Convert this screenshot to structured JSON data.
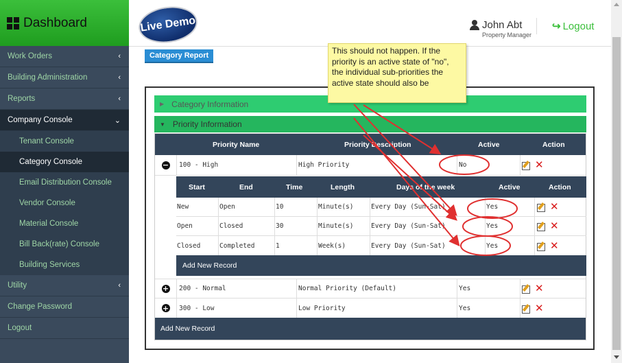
{
  "brand": {
    "title": "Dashboard"
  },
  "sidebar": {
    "items": [
      {
        "label": "Work Orders",
        "chevron": "‹"
      },
      {
        "label": "Building Administration",
        "chevron": "‹"
      },
      {
        "label": "Reports",
        "chevron": "‹"
      },
      {
        "label": "Company Console",
        "chevron": "⌄"
      }
    ],
    "sub_items": [
      {
        "label": "Tenant Console"
      },
      {
        "label": "Category Console"
      },
      {
        "label": "Email Distribution Console"
      },
      {
        "label": "Vendor Console"
      },
      {
        "label": "Material Console"
      },
      {
        "label": "Bill Back(rate) Console"
      },
      {
        "label": "Building Services"
      }
    ],
    "bottom_items": [
      {
        "label": "Utility",
        "chevron": "‹"
      },
      {
        "label": "Change Password"
      },
      {
        "label": "Logout"
      }
    ]
  },
  "header": {
    "logo_text": "Live Demo",
    "user_name": "John Abt",
    "user_role": "Property Manager",
    "logout_label": "Logout"
  },
  "page": {
    "report_button": "Category Report",
    "accordion_category": "Category Information",
    "accordion_priority": "Priority Information"
  },
  "priority_table": {
    "headers": {
      "name": "Priority Name",
      "description": "Priority Description",
      "active": "Active",
      "action": "Action"
    },
    "rows": [
      {
        "name": "100 - High",
        "description": "High Priority",
        "active": "No",
        "toggle": "−"
      },
      {
        "name": "200 - Normal",
        "description": "Normal Priority (Default)",
        "active": "Yes",
        "toggle": "+"
      },
      {
        "name": "300 - Low",
        "description": "Low Priority",
        "active": "Yes",
        "toggle": "+"
      }
    ],
    "add_new": "Add New Record"
  },
  "sub_priority_table": {
    "headers": {
      "start": "Start",
      "end": "End",
      "time": "Time",
      "length": "Length",
      "days": "Days of the week",
      "active": "Active",
      "action": "Action"
    },
    "rows": [
      {
        "start": "New",
        "end": "Open",
        "time": "10",
        "length": "Minute(s)",
        "days": "Every Day (Sun-Sat)",
        "active": "Yes"
      },
      {
        "start": "Open",
        "end": "Closed",
        "time": "30",
        "length": "Minute(s)",
        "days": "Every Day (Sun-Sat)",
        "active": "Yes"
      },
      {
        "start": "Closed",
        "end": "Completed",
        "time": "1",
        "length": "Week(s)",
        "days": "Every Day (Sun-Sat)",
        "active": "Yes"
      }
    ],
    "add_new": "Add New Record"
  },
  "annotation": {
    "text": "This should not happen.  If the priority is an active state of \"no\", the individual sub-priorities the active state should also be"
  },
  "colors": {
    "brand_green": "#2ecc71",
    "sidebar_bg": "#3a4a5c",
    "table_header": "#33455a",
    "annotation_red": "#e03030"
  }
}
